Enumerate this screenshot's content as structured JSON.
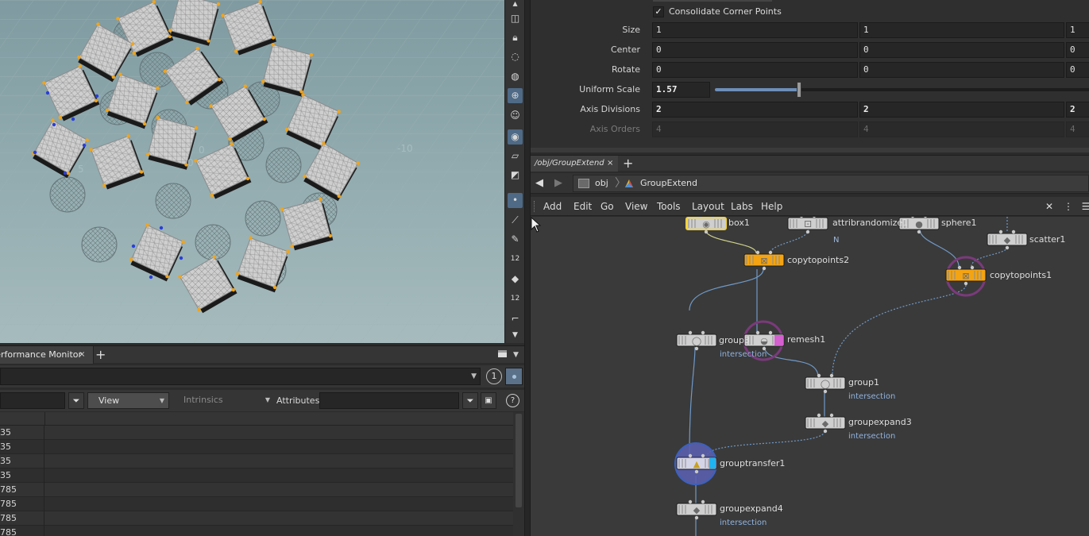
{
  "app": {
    "accent": "#f4a412",
    "selection_outline": "#f2d23a"
  },
  "viewport": {
    "grid_labels": [
      "-10",
      "0",
      "0",
      "5"
    ],
    "toolbar_icons": [
      "select-icon",
      "lock-icon",
      "light-icon",
      "camera-icon",
      "snap-icon",
      "point-icon",
      "ghost-icon",
      "shading-icon",
      "background-icon",
      "display-icon",
      "point-display-icon",
      "brush-icon",
      "paint-icon",
      "number-icon",
      "bucket-icon",
      "number-icon",
      "angle-icon"
    ],
    "toolbar_labels": [
      "12",
      "12"
    ]
  },
  "performance_monitor": {
    "tab_label": "Performance Monitor",
    "tab_close": "×",
    "tab_add": "+",
    "pane_number": "1",
    "view_label": "View",
    "intrinsics_label": "Intrinsics",
    "attributes_label": "Attributes:",
    "help": "?",
    "rows": [
      "35",
      "35",
      "35",
      "35",
      "785",
      "785",
      "785",
      "785"
    ]
  },
  "parameters": {
    "consolidate_label": "Consolidate Corner Points",
    "consolidate_checked": "✓",
    "size": {
      "label": "Size",
      "values": [
        "1",
        "1",
        "1"
      ]
    },
    "center": {
      "label": "Center",
      "values": [
        "0",
        "0",
        "0"
      ]
    },
    "rotate": {
      "label": "Rotate",
      "values": [
        "0",
        "0",
        "0"
      ]
    },
    "uniform_scale": {
      "label": "Uniform Scale",
      "value": "1.57",
      "slider_fraction": 0.22
    },
    "axis_divisions": {
      "label": "Axis Divisions",
      "values": [
        "2",
        "2",
        "2"
      ]
    },
    "axis_orders": {
      "label": "Axis Orders",
      "values": [
        "4",
        "4",
        "4"
      ]
    }
  },
  "network": {
    "tab_label": "/obj/GroupExtend",
    "tab_close": "×",
    "tab_add": "+",
    "path": {
      "root": "obj",
      "current": "GroupExtend"
    },
    "menu": [
      "Add",
      "Edit",
      "Go",
      "View",
      "Tools",
      "Layout",
      "Labs",
      "Help"
    ],
    "nodes": {
      "box1": "box1",
      "attribrandomize1": "attribrandomize1",
      "sphere1": "sphere1",
      "scatter1": "scatter1",
      "copytopoints2": "copytopoints2",
      "copytopoints1": "copytopoints1",
      "group3": "group3",
      "remesh1": "remesh1",
      "group1": "group1",
      "groupexpand3": "groupexpand3",
      "grouptransfer1": "grouptransfer1",
      "groupexpand4": "groupexpand4"
    },
    "sub_labels": {
      "attribrandomize_flag": "N",
      "group3": "intersection",
      "group1": "intersection",
      "groupexpand3": "intersection",
      "groupexpand4": "intersection"
    }
  }
}
